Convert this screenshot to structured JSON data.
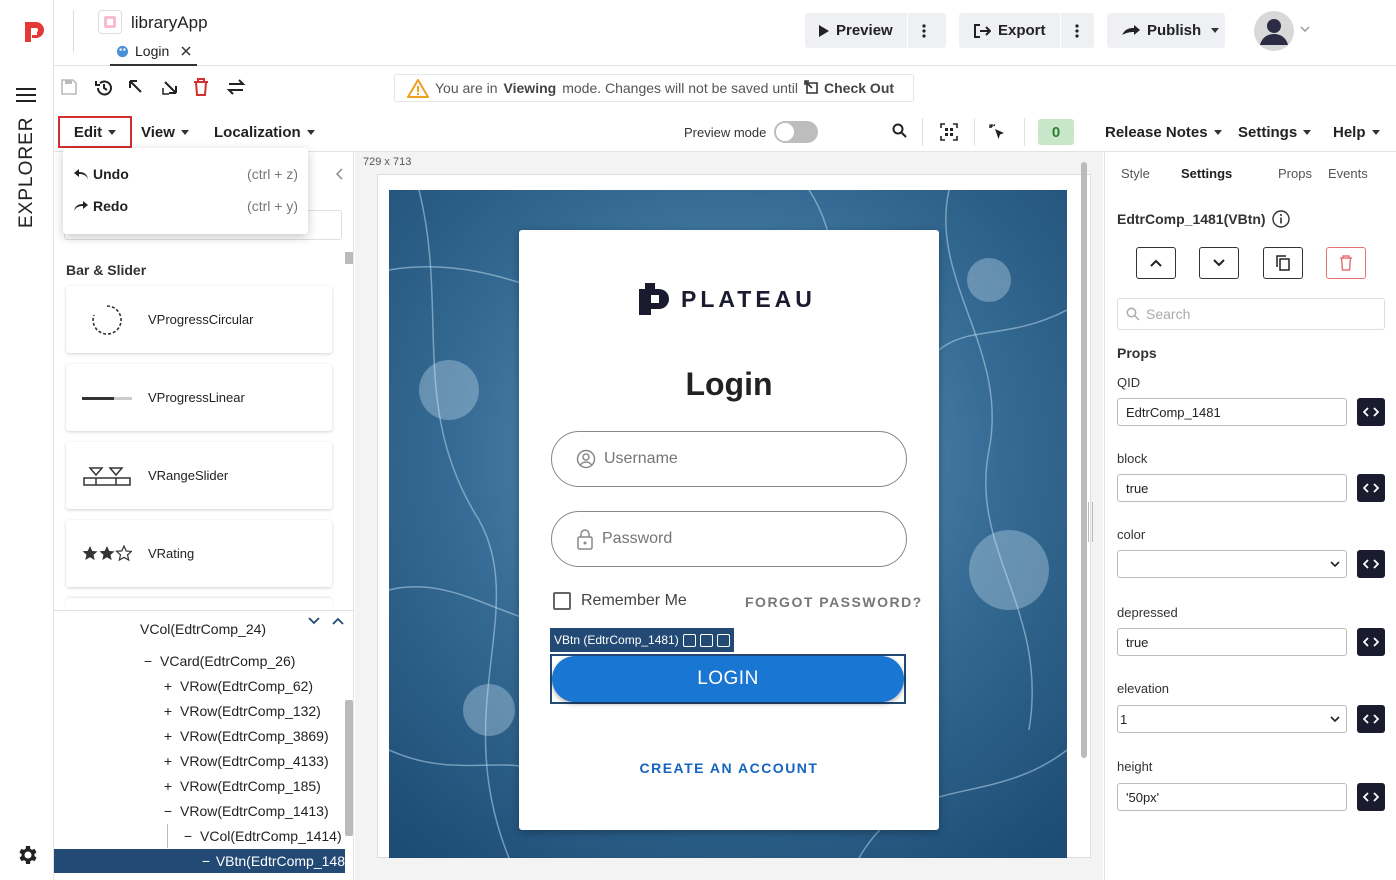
{
  "app": {
    "name": "libraryApp",
    "page_tab": "Login"
  },
  "header": {
    "preview_label": "Preview",
    "export_label": "Export",
    "publish_label": "Publish"
  },
  "banner": {
    "prefix": "You are in",
    "mode": "Viewing",
    "suffix": "mode. Changes will not be saved until",
    "action": "Check Out"
  },
  "menubar": {
    "edit": "Edit",
    "view": "View",
    "localization": "Localization",
    "preview_mode": "Preview mode",
    "count": "0",
    "release_notes": "Release Notes",
    "settings": "Settings",
    "help": "Help"
  },
  "edit_menu": [
    {
      "label": "Undo",
      "shortcut": "(ctrl + z)"
    },
    {
      "label": "Redo",
      "shortcut": "(ctrl + y)"
    }
  ],
  "sidebar": {
    "explorer_label": "EXPLORER"
  },
  "components": {
    "section": "Bar & Slider",
    "items": [
      "VProgressCircular",
      "VProgressLinear",
      "VRangeSlider",
      "VRating"
    ]
  },
  "tree": [
    {
      "sym": "",
      "label": "VCol(EdtrComp_24)"
    },
    {
      "sym": "−",
      "label": "VCard(EdtrComp_26)"
    },
    {
      "sym": "+",
      "label": "VRow(EdtrComp_62)"
    },
    {
      "sym": "+",
      "label": "VRow(EdtrComp_132)"
    },
    {
      "sym": "+",
      "label": "VRow(EdtrComp_3869)"
    },
    {
      "sym": "+",
      "label": "VRow(EdtrComp_4133)"
    },
    {
      "sym": "+",
      "label": "VRow(EdtrComp_185)"
    },
    {
      "sym": "−",
      "label": "VRow(EdtrComp_1413)"
    },
    {
      "sym": "−",
      "label": "VCol(EdtrComp_1414)"
    },
    {
      "sym": "−",
      "label": "VBtn(EdtrComp_148"
    }
  ],
  "canvas": {
    "size_label": "729 x 713",
    "brand": "PLATEAU",
    "title": "Login",
    "username_placeholder": "Username",
    "password_placeholder": "Password",
    "remember_me": "Remember Me",
    "forgot_password": "FORGOT PASSWORD?",
    "selection_tag": "VBtn (EdtrComp_1481)",
    "login_button": "LOGIN",
    "create_account": "CREATE AN ACCOUNT"
  },
  "right_panel": {
    "tabs": [
      "Style",
      "Settings",
      "Props",
      "Events"
    ],
    "active_tab": "Settings",
    "component_title": "EdtrComp_1481(VBtn)",
    "search_placeholder": "Search",
    "props_heading": "Props",
    "props": [
      {
        "label": "QID",
        "value": "EdtrComp_1481",
        "type": "text"
      },
      {
        "label": "block",
        "value": "true",
        "type": "text"
      },
      {
        "label": "color",
        "value": "",
        "type": "select"
      },
      {
        "label": "depressed",
        "value": "true",
        "type": "text"
      },
      {
        "label": "elevation",
        "value": "1",
        "type": "select"
      },
      {
        "label": "height",
        "value": "'50px'",
        "type": "text"
      }
    ]
  },
  "colors": {
    "accent": "#1976d2",
    "brand_red": "#e53935",
    "selection": "#234a75",
    "highlight": "#d32f2f",
    "dark": "#1b1b2f"
  }
}
